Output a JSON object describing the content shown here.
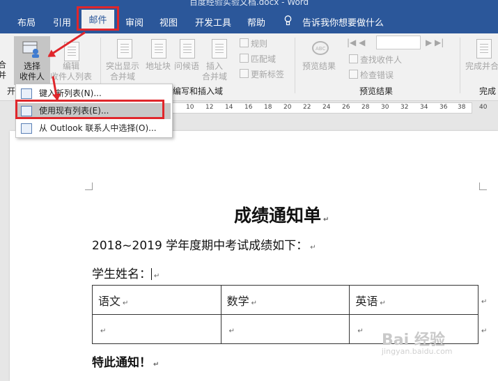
{
  "app": {
    "title": "百度经验实验文档.docx - Word"
  },
  "tabs": [
    "布局",
    "引用",
    "邮件",
    "审阅",
    "视图",
    "开发工具",
    "帮助"
  ],
  "tell_me": "告诉我你想要做什么",
  "ribbon": {
    "start_merge_label": "开始\n邮件合并",
    "select_recipients": "选择\n收件人",
    "edit_recipients": "编辑\n收件人列表",
    "highlight_fields": "突出显示\n合并域",
    "address_block": "地址块",
    "greeting_line": "问候语",
    "insert_merge_field": "插入\n合并域",
    "rules": "规则",
    "match_fields": "匹配域",
    "update_labels": "更新标签",
    "group_write_insert": "编写和插入域",
    "preview_results": "预览结果",
    "find_recipient": "查找收件人",
    "check_errors": "检查错误",
    "group_preview": "预览结果",
    "finish_merge": "完成并合并",
    "group_finish": "完成",
    "group_start_partial": "开"
  },
  "menu": {
    "items": [
      {
        "label": "键入新列表(N)..."
      },
      {
        "label": "使用现有列表(E)..."
      },
      {
        "label": "从 Outlook 联系人中选择(O)..."
      }
    ]
  },
  "ruler": {
    "ticks": [
      "10",
      "12",
      "14",
      "16",
      "18",
      "20",
      "22",
      "24",
      "26",
      "28",
      "30",
      "32",
      "34",
      "36",
      "38",
      "40"
    ]
  },
  "document": {
    "title": "成绩通知单",
    "intro": "2018~2019 学年度期中考试成绩如下：",
    "student_name_label": "学生姓名：",
    "table_headers": [
      "语文",
      "数学",
      "英语"
    ],
    "closing": "特此通知！",
    "paragraph_mark": "↵"
  },
  "watermark": {
    "brand": "Bai 经验",
    "url": "jingyan.baidu.com"
  },
  "colors": {
    "ribbon_blue": "#2b579a",
    "highlight_red": "#e0262b"
  }
}
